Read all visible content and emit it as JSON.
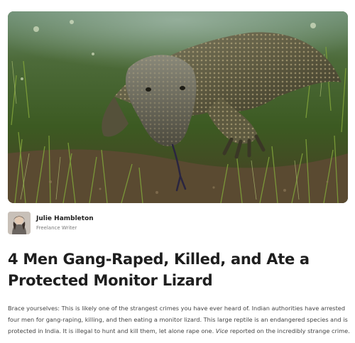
{
  "hero": {
    "icon": "monitor-lizard-photo"
  },
  "author": {
    "name": "Julie Hambleton",
    "role": "Freelance Writer",
    "avatar_icon": "author-avatar"
  },
  "article": {
    "title": "4 Men Gang-Raped, Killed, and Ate a Protected Monitor Lizard",
    "body_part1": "Brace yourselves: This is likely one of the strangest crimes you have ever heard of. Indian authorities have arrested four men for gang-raping, killing, and then eating a monitor lizard. This large reptile is an endangered species and is protected in India. It is illegal to hunt and kill them, let alone rape one. ",
    "body_source": "Vice",
    "body_part2": " reported on the incredibly strange crime."
  }
}
